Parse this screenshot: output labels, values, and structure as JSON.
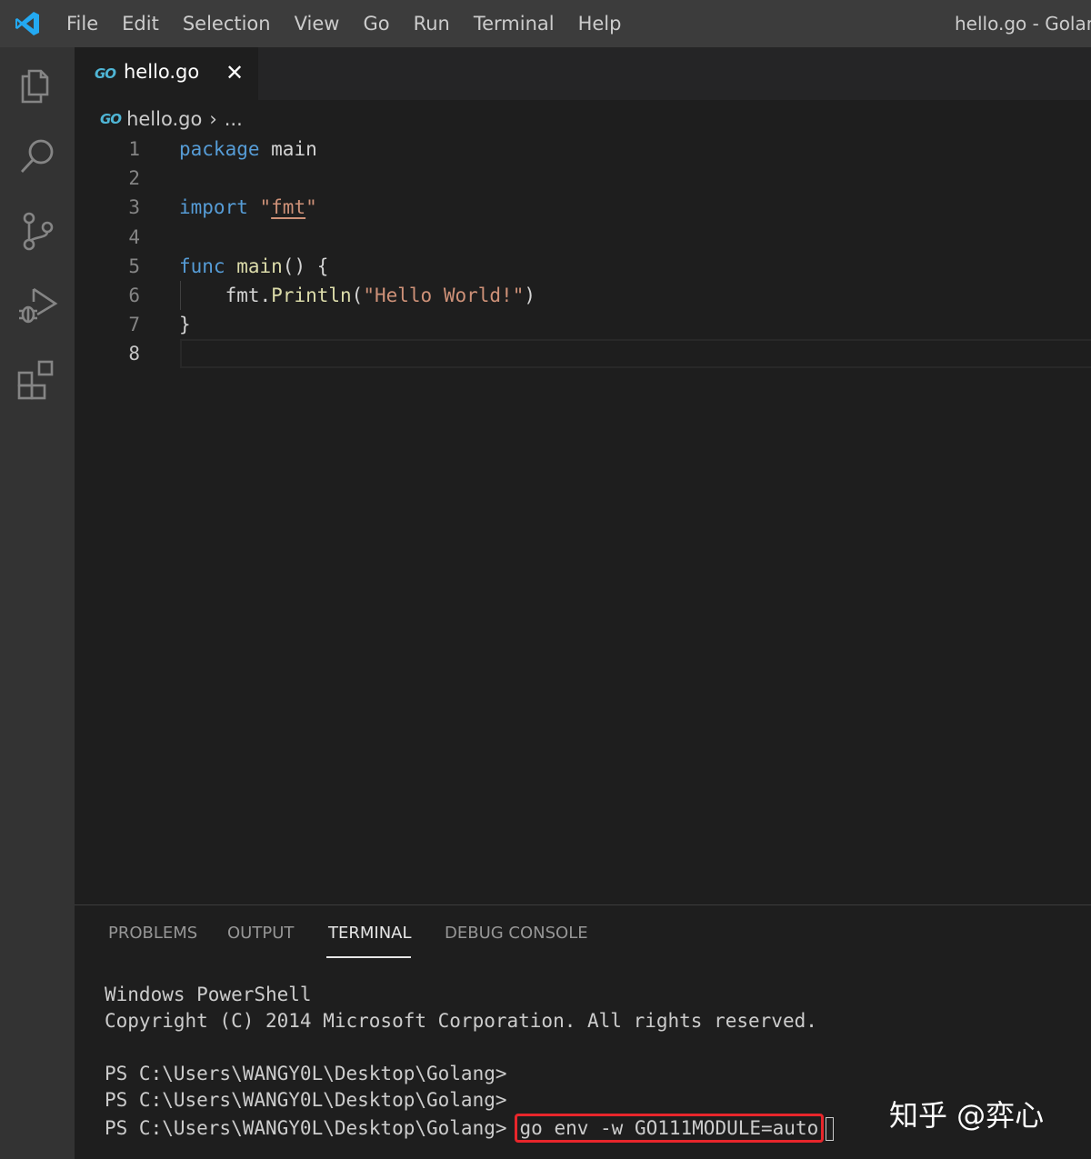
{
  "menubar": {
    "items": [
      "File",
      "Edit",
      "Selection",
      "View",
      "Go",
      "Run",
      "Terminal",
      "Help"
    ],
    "window_title": "hello.go - Golang"
  },
  "activitybar": {
    "icons": [
      "explorer-icon",
      "search-icon",
      "source-control-icon",
      "run-debug-icon",
      "extensions-icon"
    ]
  },
  "tab": {
    "badge": "GO",
    "label": "hello.go",
    "close": "✕"
  },
  "breadcrumb": {
    "badge": "GO",
    "file": "hello.go",
    "separator": "›",
    "rest": "..."
  },
  "editor": {
    "line_numbers": [
      "1",
      "2",
      "3",
      "4",
      "5",
      "6",
      "7",
      "8"
    ],
    "active_line": "8",
    "lines": {
      "l1_kw": "package",
      "l1_rest": " main",
      "l3_kw": "import",
      "l3_q1": " \"",
      "l3_str": "fmt",
      "l3_q2": "\"",
      "l5_kw": "func",
      "l5_fn": " main",
      "l5_rest": "() {",
      "l6_pre": "    fmt.",
      "l6_fn": "Println",
      "l6_paren": "(",
      "l6_str": "\"Hello World!\"",
      "l6_close": ")",
      "l7": "}"
    }
  },
  "panel": {
    "tabs": [
      "PROBLEMS",
      "OUTPUT",
      "TERMINAL",
      "DEBUG CONSOLE"
    ],
    "active_tab": "TERMINAL"
  },
  "terminal": {
    "line1": "Windows PowerShell",
    "line2": "Copyright (C) 2014 Microsoft Corporation. All rights reserved.",
    "prompt1": "PS C:\\Users\\WANGY0L\\Desktop\\Golang>",
    "prompt2": "PS C:\\Users\\WANGY0L\\Desktop\\Golang>",
    "prompt3": "PS C:\\Users\\WANGY0L\\Desktop\\Golang>",
    "command": "go env -w GO111MODULE=auto"
  },
  "watermark": "知乎 @弈心",
  "colors": {
    "keyword": "#569cd6",
    "string": "#ce9178",
    "function": "#dcdcaa",
    "highlight_box": "#e8262b",
    "go_badge": "#4fb6d6"
  }
}
